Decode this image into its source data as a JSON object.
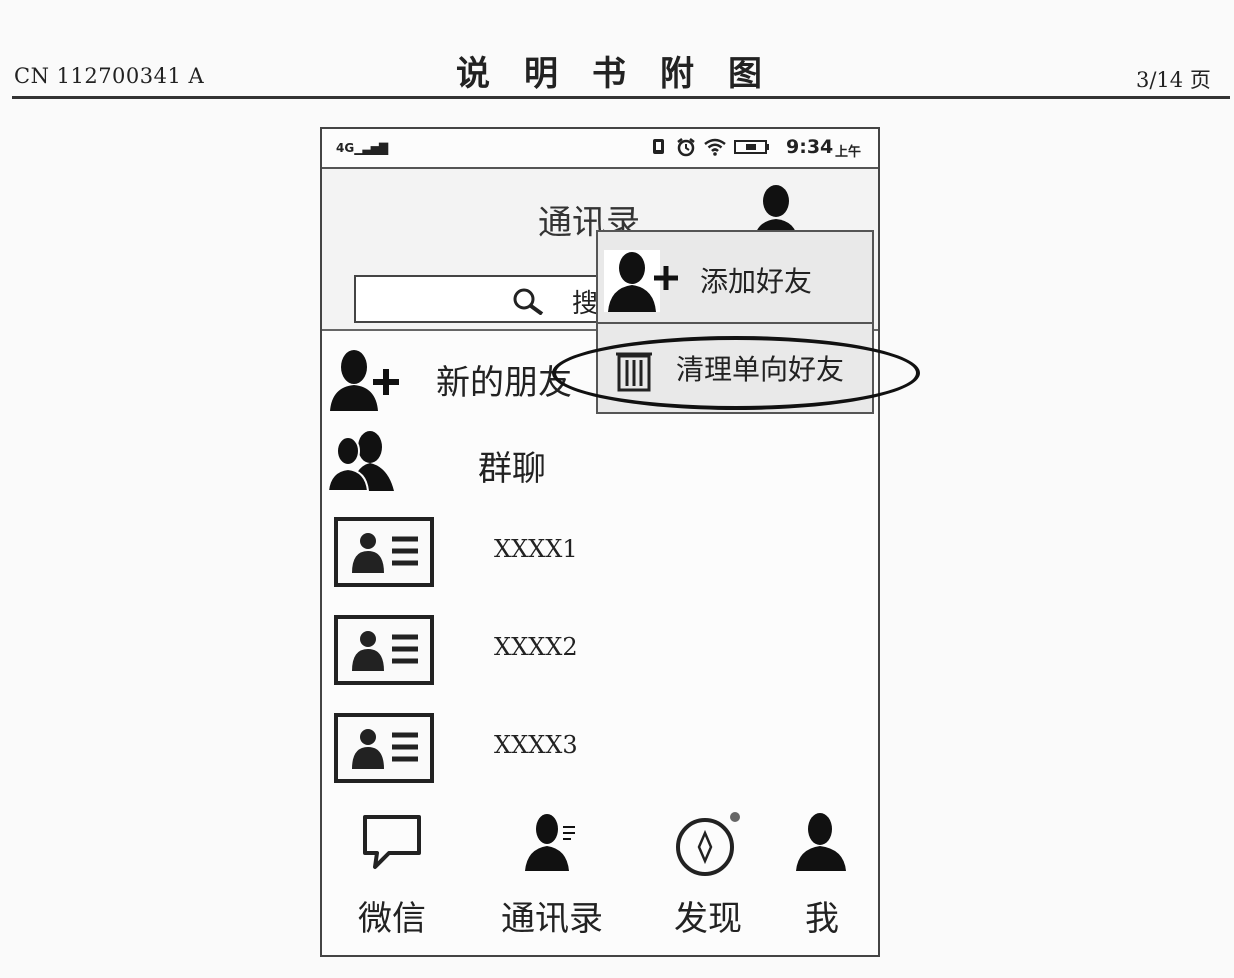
{
  "header": {
    "doc_number": "CN 112700341 A",
    "title": "说明书附图",
    "page": "3/14 页"
  },
  "status_bar": {
    "signal": "4G",
    "time": "9:34",
    "ampm": "上午",
    "icons": [
      "phone-icon",
      "alarm-icon",
      "wifi-icon",
      "battery-icon"
    ]
  },
  "top_bar": {
    "title": "通讯录",
    "search_placeholder": "搜"
  },
  "list": {
    "new_friends": "新的朋友",
    "group_chat": "群聊",
    "contacts": [
      "XXXX1",
      "XXXX2",
      "XXXX3"
    ]
  },
  "menu": {
    "items": [
      {
        "label": "添加好友",
        "icon": "add-user-icon"
      },
      {
        "label": "清理单向好友",
        "icon": "trash-icon"
      }
    ]
  },
  "tabbar": {
    "items": [
      {
        "label": "微信",
        "icon": "chat-bubble-icon"
      },
      {
        "label": "通讯录",
        "icon": "contacts-icon"
      },
      {
        "label": "发现",
        "icon": "compass-icon"
      },
      {
        "label": "我",
        "icon": "user-icon"
      }
    ]
  }
}
